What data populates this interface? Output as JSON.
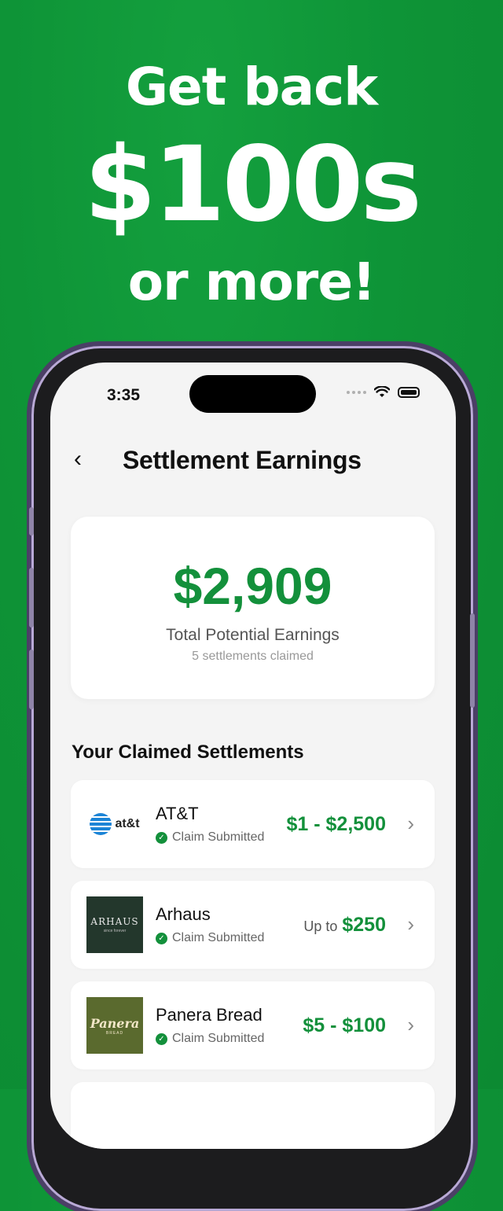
{
  "hero": {
    "line1": "Get back",
    "line2": "$100s",
    "line3": "or more!"
  },
  "status_bar": {
    "time": "3:35"
  },
  "header": {
    "title": "Settlement Earnings",
    "back_glyph": "‹"
  },
  "summary": {
    "amount": "$2,909",
    "label": "Total Potential Earnings",
    "sub": "5 settlements claimed"
  },
  "section_title": "Your Claimed Settlements",
  "settlements": [
    {
      "name": "AT&T",
      "status": "Claim Submitted",
      "prefix": "",
      "amount": "$1 - $2,500",
      "logo_text": "at&t"
    },
    {
      "name": "Arhaus",
      "status": "Claim Submitted",
      "prefix": "Up to",
      "amount": "$250",
      "logo_text": "ARHAUS",
      "logo_sub": "since forever"
    },
    {
      "name": "Panera Bread",
      "status": "Claim Submitted",
      "prefix": "",
      "amount": "$5 - $100",
      "logo_text": "Panera",
      "logo_sub": "BREAD"
    }
  ],
  "colors": {
    "brand_green": "#13903b",
    "background_green": "#0e9437"
  }
}
